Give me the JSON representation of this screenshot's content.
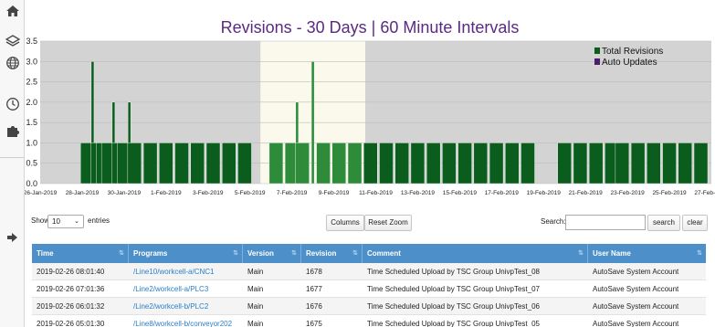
{
  "sidebar": {
    "icons": [
      "home-icon",
      "layers-icon",
      "globe-icon",
      "clock-icon",
      "puzzle-icon",
      "logout-icon"
    ]
  },
  "chart_title": "Revisions - 30 Days | 60 Minute Intervals",
  "chart_data": {
    "type": "bar",
    "title": "Revisions - 30 Days | 60 Minute Intervals",
    "xlabel": "",
    "ylabel": "",
    "ylim": [
      0,
      3.5
    ],
    "yticks": [
      "0.0",
      "0.5",
      "1.0",
      "1.5",
      "2.0",
      "2.5",
      "3.0",
      "3.5"
    ],
    "xlim": [
      "26-Jan-2019",
      "27-Feb-2019"
    ],
    "xticks": [
      "26-Jan-2019",
      "28-Jan-2019",
      "30-Jan-2019",
      "1-Feb-2019",
      "3-Feb-2019",
      "5-Feb-2019",
      "7-Feb-2019",
      "9-Feb-2019",
      "11-Feb-2019",
      "13-Feb-2019",
      "15-Feb-2019",
      "17-Feb-2019",
      "19-Feb-2019",
      "21-Feb-2019",
      "23-Feb-2019",
      "25-Feb-2019",
      "27-Feb-2019"
    ],
    "grid": true,
    "legend_position": "top-right",
    "highlight_range": [
      "5-Feb-2019 12:00",
      "10-Feb-2019 12:00"
    ],
    "series": [
      {
        "name": "Total Revisions",
        "color": "#0b5d1e",
        "points": [
          [
            "28-Jan-2019 06:00",
            1
          ],
          [
            "28-Jan-2019 12:00",
            3
          ],
          [
            "28-Jan-2019 18:00",
            1
          ],
          [
            "29-Jan-2019 00:00",
            1
          ],
          [
            "29-Jan-2019 06:00",
            1
          ],
          [
            "29-Jan-2019 12:00",
            2
          ],
          [
            "29-Jan-2019 18:00",
            1
          ],
          [
            "30-Jan-2019 00:00",
            1
          ],
          [
            "30-Jan-2019 06:00",
            2
          ],
          [
            "30-Jan-2019 12:00",
            1
          ],
          [
            "31-Jan-2019 06:00",
            1
          ],
          [
            "1-Feb-2019 00:00",
            1
          ],
          [
            "1-Feb-2019 18:00",
            1
          ],
          [
            "2-Feb-2019 12:00",
            1
          ],
          [
            "3-Feb-2019 06:00",
            1
          ],
          [
            "4-Feb-2019 00:00",
            1
          ],
          [
            "4-Feb-2019 18:00",
            1
          ],
          [
            "6-Feb-2019 06:00",
            1
          ],
          [
            "7-Feb-2019 00:00",
            1
          ],
          [
            "7-Feb-2019 06:00",
            2
          ],
          [
            "7-Feb-2019 12:00",
            1
          ],
          [
            "8-Feb-2019 00:00",
            3
          ],
          [
            "8-Feb-2019 12:00",
            1
          ],
          [
            "9-Feb-2019 06:00",
            1
          ],
          [
            "10-Feb-2019 00:00",
            1
          ],
          [
            "10-Feb-2019 18:00",
            1
          ],
          [
            "11-Feb-2019 12:00",
            1
          ],
          [
            "12-Feb-2019 06:00",
            1
          ],
          [
            "13-Feb-2019 00:00",
            1
          ],
          [
            "13-Feb-2019 18:00",
            1
          ],
          [
            "14-Feb-2019 12:00",
            1
          ],
          [
            "15-Feb-2019 06:00",
            1
          ],
          [
            "16-Feb-2019 00:00",
            1
          ],
          [
            "16-Feb-2019 18:00",
            1
          ],
          [
            "17-Feb-2019 12:00",
            1
          ],
          [
            "18-Feb-2019 06:00",
            1
          ],
          [
            "20-Feb-2019 00:00",
            1
          ],
          [
            "20-Feb-2019 18:00",
            1
          ],
          [
            "21-Feb-2019 12:00",
            1
          ],
          [
            "22-Feb-2019 06:00",
            1
          ],
          [
            "22-Feb-2019 18:00",
            1
          ],
          [
            "23-Feb-2019 12:00",
            1
          ],
          [
            "24-Feb-2019 06:00",
            1
          ],
          [
            "25-Feb-2019 00:00",
            1
          ],
          [
            "25-Feb-2019 18:00",
            1
          ],
          [
            "26-Feb-2019 12:00",
            1
          ]
        ]
      },
      {
        "name": "Auto Updates",
        "color": "#4b1d6e",
        "points": []
      }
    ]
  },
  "controls": {
    "show_label": "Show",
    "page_size": "10",
    "entries_label": "entries",
    "columns_button": "Columns",
    "reset_zoom_button": "Reset Zoom",
    "search_label": "Search:",
    "search_value": "",
    "search_button": "search",
    "clear_button": "clear"
  },
  "table": {
    "columns": [
      "Time",
      "Programs",
      "Version",
      "Revision",
      "Comment",
      "User Name"
    ],
    "rows": [
      [
        "2019-02-26 08:01:40",
        "/Line10/workcell-a/CNC1",
        "Main",
        "1678",
        "Time Scheduled Upload by TSC Group UnivpTest_08",
        "AutoSave System Account"
      ],
      [
        "2019-02-26 07:01:36",
        "/Line2/workcell-a/PLC3",
        "Main",
        "1677",
        "Time Scheduled Upload by TSC Group UnivpTest_07",
        "AutoSave System Account"
      ],
      [
        "2019-02-26 06:01:32",
        "/Line2/workcell-b/PLC2",
        "Main",
        "1676",
        "Time Scheduled Upload by TSC Group UnivpTest_06",
        "AutoSave System Account"
      ],
      [
        "2019-02-26 05:01:30",
        "/Line8/workcell-b/conveyor202",
        "Main",
        "1675",
        "Time Scheduled Upload by TSC Group UnivpTest_05",
        "AutoSave System Account"
      ]
    ]
  }
}
